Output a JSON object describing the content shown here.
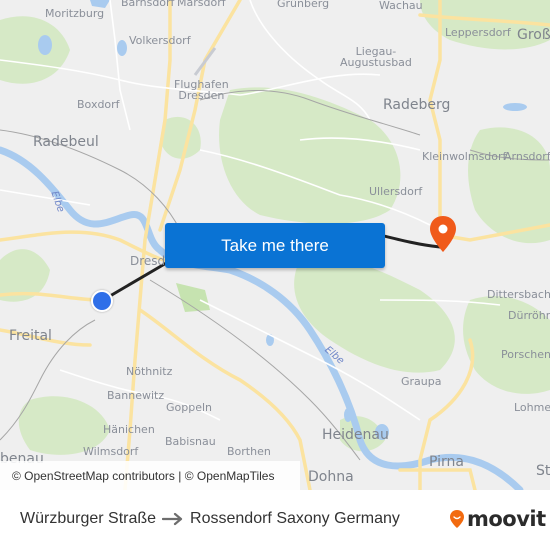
{
  "map": {
    "places": [
      {
        "id": "moritzburg",
        "label": "Moritzburg"
      },
      {
        "id": "barnsdorf",
        "label": "Bärnsdorf"
      },
      {
        "id": "marsdorf",
        "label": "Marsdorf"
      },
      {
        "id": "grunberg",
        "label": "Grünberg"
      },
      {
        "id": "wachau",
        "label": "Wachau"
      },
      {
        "id": "leppersdorf",
        "label": "Leppersdorf"
      },
      {
        "id": "gross",
        "label": "Groß"
      },
      {
        "id": "volkersdorf",
        "label": "Volkersdorf"
      },
      {
        "id": "flughafen",
        "label": "Flughafen\nDresden"
      },
      {
        "id": "liegau",
        "label": "Liegau-\nAugustusbad"
      },
      {
        "id": "boxdorf",
        "label": "Boxdorf"
      },
      {
        "id": "radeberg",
        "label": "Radeberg"
      },
      {
        "id": "radebeul",
        "label": "Radebeul"
      },
      {
        "id": "kleinwolmsdorf",
        "label": "Kleinwolmsdorf"
      },
      {
        "id": "arnsdorf",
        "label": "Arnsdorf"
      },
      {
        "id": "ullersdorf",
        "label": "Ullersdorf"
      },
      {
        "id": "dresden",
        "label": "Dresden"
      },
      {
        "id": "freital",
        "label": "Freital"
      },
      {
        "id": "dittersbach",
        "label": "Dittersbach"
      },
      {
        "id": "durrrohrsdorf",
        "label": "Dürröhr"
      },
      {
        "id": "porschendorf",
        "label": "Porschend"
      },
      {
        "id": "nothnitz",
        "label": "Nöthnitz"
      },
      {
        "id": "bannewitz",
        "label": "Bannewitz"
      },
      {
        "id": "goppeln",
        "label": "Goppeln"
      },
      {
        "id": "graupa",
        "label": "Graupa"
      },
      {
        "id": "lohmen",
        "label": "Lohmer"
      },
      {
        "id": "hanichen",
        "label": "Hänichen"
      },
      {
        "id": "babisnau",
        "label": "Babisnau"
      },
      {
        "id": "heidenau",
        "label": "Heidenau"
      },
      {
        "id": "borthen",
        "label": "Borthen"
      },
      {
        "id": "wilmsdorf",
        "label": "Wilmsdorf"
      },
      {
        "id": "tharandt",
        "label": "benau"
      },
      {
        "id": "pirna",
        "label": "Pirna"
      },
      {
        "id": "dohna",
        "label": "Dohna"
      },
      {
        "id": "stadt",
        "label": "St"
      }
    ],
    "rivers": [
      {
        "id": "elbe-west",
        "label": "Elbe"
      },
      {
        "id": "elbe-east",
        "label": "Elbe"
      }
    ],
    "colors": {
      "background": "#efefef",
      "forest": "#d4e8c4",
      "water": "#a9cbef",
      "road_major": "#fbe8a3",
      "route": "#222222",
      "origin": "#2f6fe8",
      "destination": "#f05a1a"
    },
    "cta": {
      "label": "Take me there"
    },
    "origin_marker": {
      "name": "Würzburger Straße"
    },
    "destination_marker": {
      "name": "Rossendorf Saxony Germany"
    },
    "attribution": {
      "osm": "© OpenStreetMap contributors",
      "separator": " | ",
      "omt": "© OpenMapTiles"
    }
  },
  "footer": {
    "origin": "Würzburger Straße",
    "destination": "Rossendorf Saxony Germany",
    "brand": "moovit",
    "brand_color": "#f26a0f"
  }
}
